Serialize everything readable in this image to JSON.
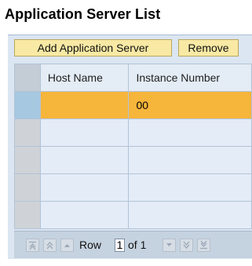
{
  "page": {
    "title": "Application Server List"
  },
  "toolbar": {
    "add_label": "Add Application Server",
    "remove_label": "Remove"
  },
  "table": {
    "columns": [
      "Host Name",
      "Instance Number"
    ],
    "rows": [
      {
        "host": "",
        "instance": "00",
        "selected": true
      },
      {
        "host": "",
        "instance": ""
      },
      {
        "host": "",
        "instance": ""
      },
      {
        "host": "",
        "instance": ""
      },
      {
        "host": "",
        "instance": ""
      }
    ]
  },
  "pager": {
    "row_label": "Row",
    "current": "1",
    "of_label": "of 1",
    "icons": [
      "first-page-icon",
      "previous-page-icon",
      "previous-row-icon",
      "next-row-icon",
      "next-page-icon",
      "last-page-icon"
    ]
  },
  "colors": {
    "toolbar_button": "#f8e9a4",
    "selected_row": "#f6b53b",
    "panel": "#dbe6f2"
  }
}
